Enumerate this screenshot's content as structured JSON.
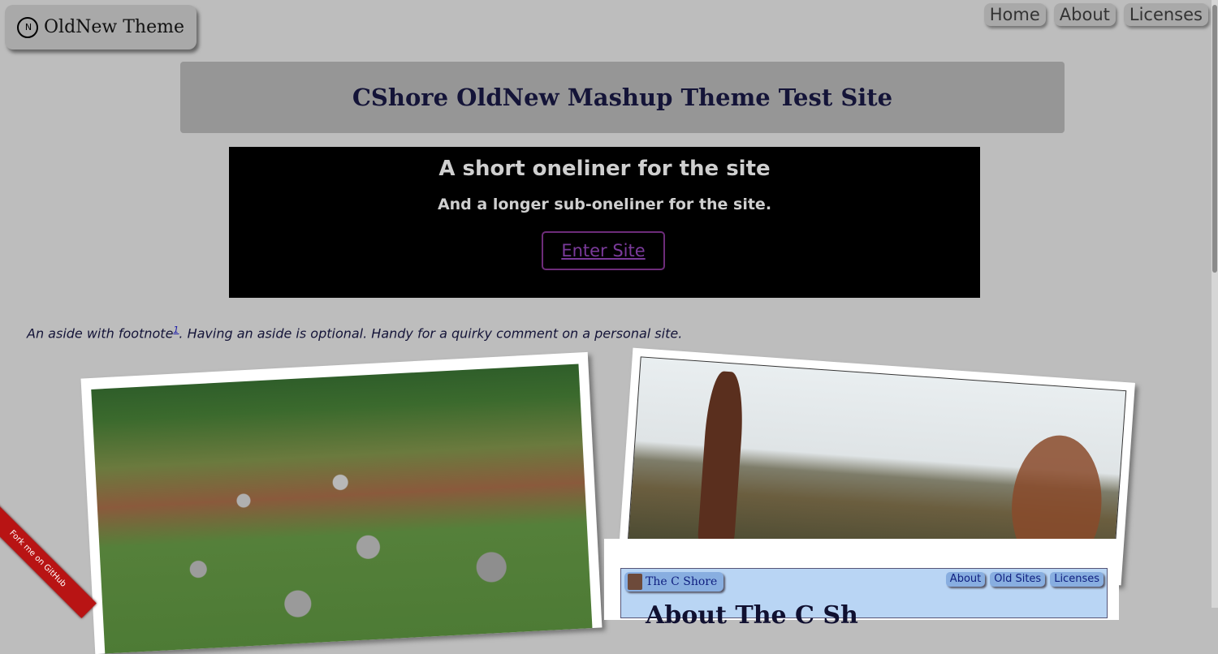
{
  "brand": {
    "logo": "N",
    "name": "OldNew Theme"
  },
  "nav": [
    "Home",
    "About",
    "Licenses"
  ],
  "header": {
    "title": "CShore OldNew Mashup Theme Test Site"
  },
  "hero": {
    "title": "A short oneliner for the site",
    "subtitle": "And a longer sub-oneliner for the site.",
    "cta": "Enter Site"
  },
  "aside": {
    "before": "An aside with footnote",
    "footnote": "1",
    "after": ". Having an aside is optional. Handy for a quirky comment on a personal site."
  },
  "screenshot": {
    "brand": "The C Shore",
    "nav": [
      "About",
      "Old Sites",
      "Licenses"
    ],
    "heading": "About The C Sh"
  },
  "ribbon": "Fork me on GitHub",
  "colors": {
    "background": "#bdbdbd",
    "hero_bg": "#000000",
    "title": "#141438",
    "cta": "#7a3a9a"
  }
}
